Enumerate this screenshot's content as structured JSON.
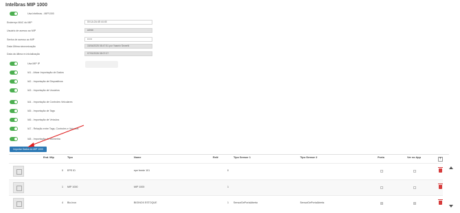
{
  "page": {
    "title": "Intelbras MIP 1000"
  },
  "settings": {
    "use_mip_label": "Usa Intelbras - MIP1000",
    "fields": [
      {
        "label": "Endereço MAC do MIP",
        "value": "00:1A:2A:4E:44:45"
      },
      {
        "label": "Usuário de acesso ao MIP",
        "value": "admin"
      },
      {
        "label": "Senha de acesso ao MIP",
        "value": "••••••"
      },
      {
        "label": "Data Última sincronização",
        "value": "15/04/2025 08:47:51 por Yasmin Severiti"
      },
      {
        "label": "Data da última re-inicialização",
        "value": "07/01/2026 08:07:07"
      }
    ],
    "toggles": [
      "Usa MIP IP",
      "IA1 - Ativar Importação de Dados",
      "IA2 - Importação de Dispositivos",
      "IA3 - Importação de Usuários",
      "IA4 - Importação de Controles Veiculares",
      "IA5 - Importação de Tags",
      "IA6 - Importação de Veículos",
      "IA7 - Relação entre Tags, Controles e Veículos",
      "IA8 - Importação de Biometria"
    ]
  },
  "import_button": "Importar Dados do MIP 1000",
  "grid": {
    "columns": [
      "End. Mip",
      "Tipo",
      "Nome",
      "Relê",
      "Tipo Sensor 1",
      "Tipo Sensor 2",
      "Porta",
      "Ver no App"
    ],
    "add_symbol": "+",
    "rows": [
      {
        "end": "0",
        "tipo": "EPE ID",
        "nome": "epe frente 101",
        "rele": "0",
        "sensor1": "",
        "sensor2": "",
        "porta": false,
        "ver_app": false
      },
      {
        "end": "1",
        "tipo": "MIP 1000",
        "nome": "MIP 1000",
        "rele": "1",
        "sensor1": "",
        "sensor2": "",
        "porta": false,
        "ver_app": false
      },
      {
        "end": "4",
        "tipo": "Bio-Inox",
        "nome": "BIOINOX ESTOQUE",
        "rele": "1",
        "sensor1": "SensorDePortaAberta",
        "sensor2": "SensorDePortaAberta",
        "porta": true,
        "ver_app": true
      }
    ]
  },
  "colors": {
    "toggle_on": "#4caf50",
    "button": "#2b78b4",
    "arrow": "#e02020",
    "delete": "#d63b3b"
  }
}
